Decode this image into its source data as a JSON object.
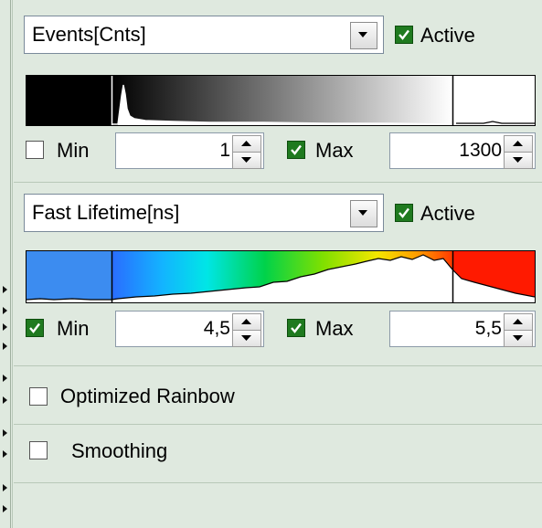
{
  "colors": {
    "panel_bg": "#dfe9df",
    "checkbox_on": "#1f7a1f",
    "histogram_line": "#000000"
  },
  "channel1": {
    "combo_value": "Events[Cnts]",
    "active_label": "Active",
    "active_checked": true,
    "colormap": "grayscale",
    "min": {
      "label": "Min",
      "checked": false,
      "value": "1"
    },
    "max": {
      "label": "Max",
      "checked": true,
      "value": "1300"
    }
  },
  "channel2": {
    "combo_value": "Fast Lifetime[ns]",
    "active_label": "Active",
    "active_checked": true,
    "colormap": "rainbow",
    "min": {
      "label": "Min",
      "checked": true,
      "value": "4,5"
    },
    "max": {
      "label": "Max",
      "checked": true,
      "value": "5,5"
    }
  },
  "options": {
    "optimized_rainbow": {
      "label": "Optimized Rainbow",
      "checked": false
    },
    "smoothing": {
      "label": "Smoothing",
      "checked": false
    }
  }
}
